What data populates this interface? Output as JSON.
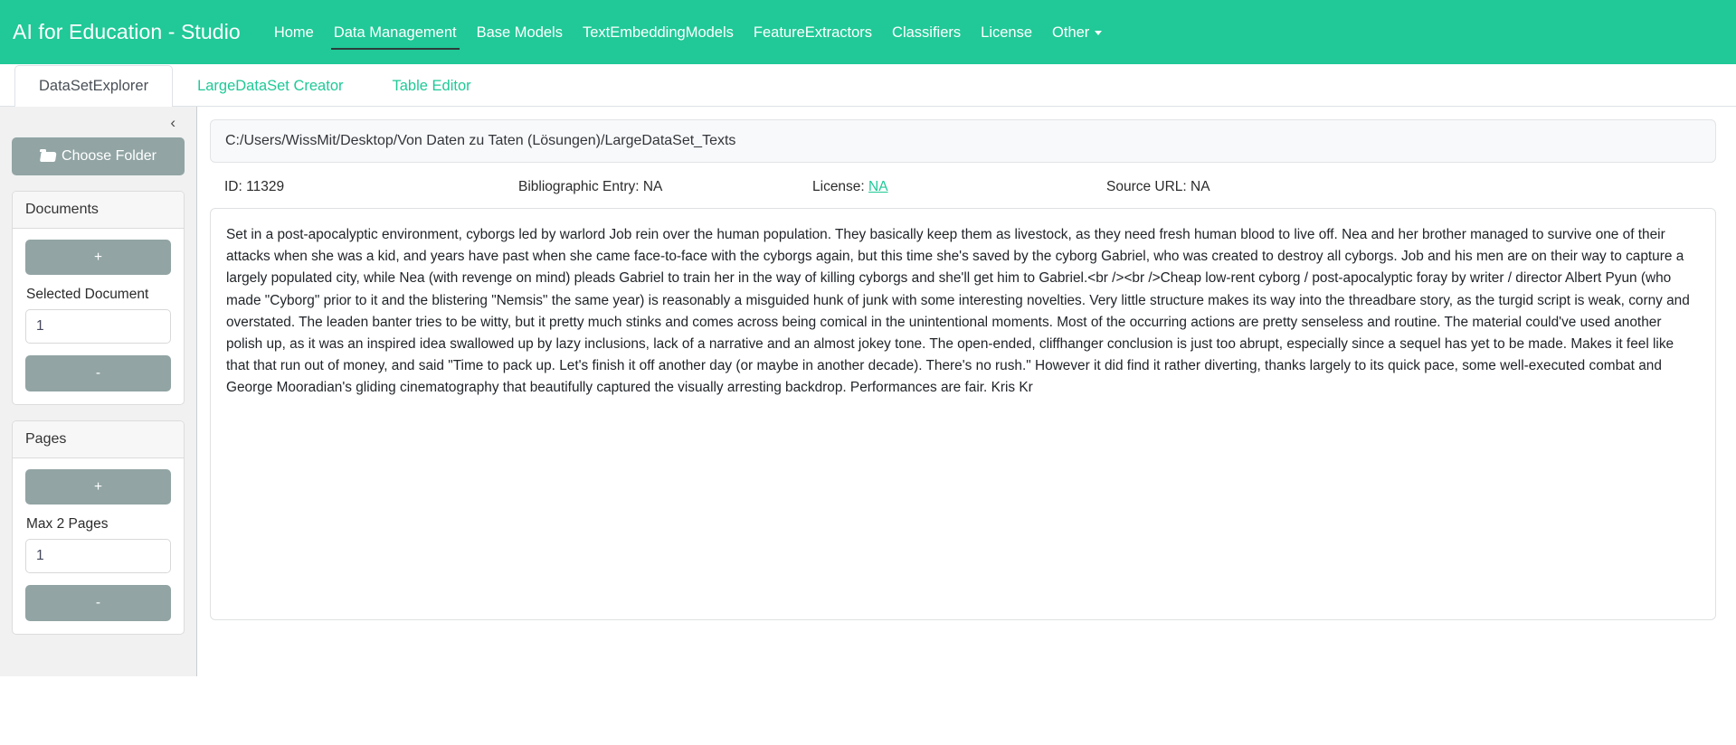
{
  "navbar": {
    "brand": "AI for Education - Studio",
    "accent_color": "#20c997",
    "links": [
      {
        "label": "Home",
        "active": false
      },
      {
        "label": "Data Management",
        "active": true
      },
      {
        "label": "Base Models",
        "active": false
      },
      {
        "label": "TextEmbeddingModels",
        "active": false
      },
      {
        "label": "FeatureExtractors",
        "active": false
      },
      {
        "label": "Classifiers",
        "active": false
      },
      {
        "label": "License",
        "active": false
      },
      {
        "label": "Other",
        "active": false,
        "has_dropdown": true
      }
    ]
  },
  "tabs": [
    {
      "label": "DataSetExplorer",
      "active": true
    },
    {
      "label": "LargeDataSet Creator",
      "active": false
    },
    {
      "label": "Table Editor",
      "active": false
    }
  ],
  "sidebar": {
    "collapse_icon": "‹",
    "choose_folder_label": "Choose Folder",
    "documents_panel": {
      "title": "Documents",
      "increment_label": "+",
      "decrement_label": "-",
      "field_label": "Selected Document",
      "field_value": "1"
    },
    "pages_panel": {
      "title": "Pages",
      "increment_label": "+",
      "decrement_label": "-",
      "field_label": "Max 2 Pages",
      "field_value": "1"
    }
  },
  "main": {
    "path": "C:/Users/WissMit/Desktop/Von Daten zu Taten (Lösungen)/LargeDataSet_Texts",
    "meta": {
      "id_label": "ID: 11329",
      "bibliographic_label": "Bibliographic Entry: NA",
      "license_prefix": "License: ",
      "license_value": "NA",
      "source_url_label": "Source URL: NA"
    },
    "document_text": "Set in a post-apocalyptic environment, cyborgs led by warlord Job rein over the human population. They basically keep them as livestock, as they need fresh human blood to live off. Nea and her brother managed to survive one of their attacks when she was a kid, and years have past when she came face-to-face with the cyborgs again, but this time she's saved by the cyborg Gabriel, who was created to destroy all cyborgs. Job and his men are on their way to capture a largely populated city, while Nea (with revenge on mind) pleads Gabriel to train her in the way of killing cyborgs and she'll get him to Gabriel.<br /><br />Cheap low-rent cyborg / post-apocalyptic foray by writer / director Albert Pyun (who made \"Cyborg\" prior to it and the blistering \"Nemsis\" the same year) is reasonably a misguided hunk of junk with some interesting novelties. Very little structure makes its way into the threadbare story, as the turgid script is weak, corny and overstated. The leaden banter tries to be witty, but it pretty much stinks and comes across being comical in the unintentional moments. Most of the occurring actions are pretty senseless and routine. The material could've used another polish up, as it was an inspired idea swallowed up by lazy inclusions, lack of a narrative and an almost jokey tone. The open-ended, cliffhanger conclusion is just too abrupt, especially since a sequel has yet to be made. Makes it feel like that that run out of money, and said \"Time to pack up. Let's finish it off another day (or maybe in another decade). There's no rush.\" However it did find it rather diverting, thanks largely to its quick pace, some well-executed combat and George Mooradian's gliding cinematography that beautifully captured the visually arresting backdrop. Performances are fair. Kris Kr"
  }
}
